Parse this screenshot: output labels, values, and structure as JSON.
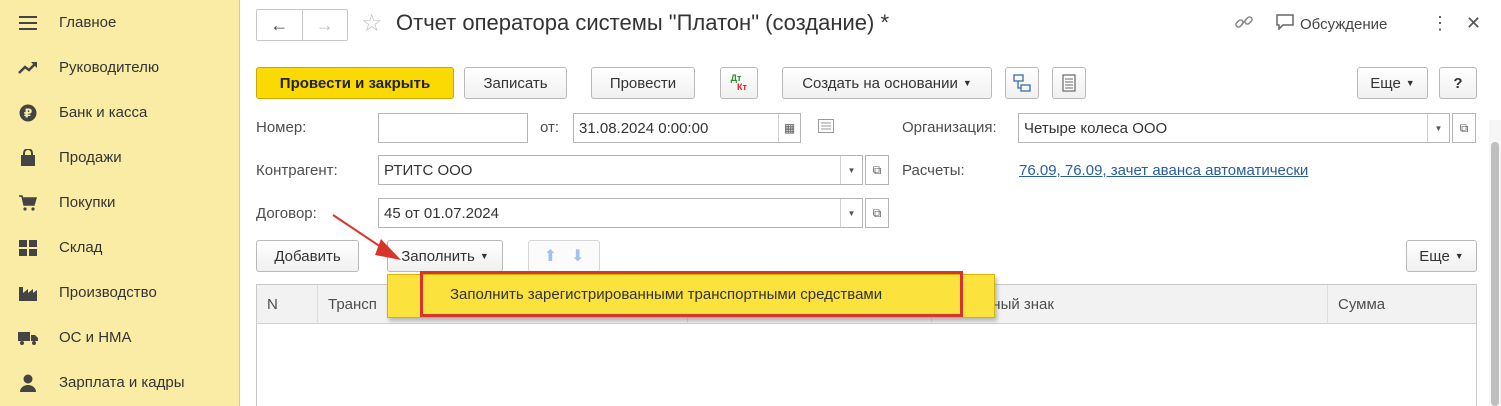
{
  "sidebar": {
    "items": [
      {
        "label": "Главное",
        "icon": "menu-icon"
      },
      {
        "label": "Руководителю",
        "icon": "trend-icon"
      },
      {
        "label": "Банк и касса",
        "icon": "ruble-icon"
      },
      {
        "label": "Продажи",
        "icon": "bag-icon"
      },
      {
        "label": "Покупки",
        "icon": "cart-icon"
      },
      {
        "label": "Склад",
        "icon": "warehouse-icon"
      },
      {
        "label": "Производство",
        "icon": "factory-icon"
      },
      {
        "label": "ОС и НМА",
        "icon": "truck-icon"
      },
      {
        "label": "Зарплата и кадры",
        "icon": "person-icon"
      }
    ]
  },
  "header": {
    "back": "←",
    "forward": "→",
    "title": "Отчет оператора системы \"Платон\" (создание) *",
    "discussion": "Обсуждение"
  },
  "toolbar": {
    "post_close": "Провести и закрыть",
    "save": "Записать",
    "post": "Провести",
    "dtkt_top": "Дт",
    "dtkt_bottom": "Кт",
    "create_based": "Создать на основании",
    "more": "Еще",
    "help": "?"
  },
  "form": {
    "number_label": "Номер:",
    "number_value": "",
    "from_label": "от:",
    "date_value": "31.08.2024  0:00:00",
    "org_label": "Организация:",
    "org_value": "Четыре колеса ООО",
    "counterparty_label": "Контрагент:",
    "counterparty_value": "РТИТС ООО",
    "settlements_label": "Расчеты:",
    "settlements_link": "76.09, 76.09, зачет аванса автоматически",
    "contract_label": "Договор:",
    "contract_value": "45 от 01.07.2024"
  },
  "table_toolbar": {
    "add": "Добавить",
    "fill": "Заполнить",
    "more": "Еще"
  },
  "table": {
    "columns": [
      "N",
      "Трансп",
      "",
      "рационный знак",
      "Сумма"
    ]
  },
  "fill_menu": {
    "item": "Заполнить зарегистрированными транспортными средствами"
  },
  "colors": {
    "sidebar_bg": "#fbeca5",
    "primary_btn": "#fbd902",
    "popup_bg": "#fbe23d",
    "highlight_border": "#d9342b",
    "link": "#2a5d9f"
  }
}
